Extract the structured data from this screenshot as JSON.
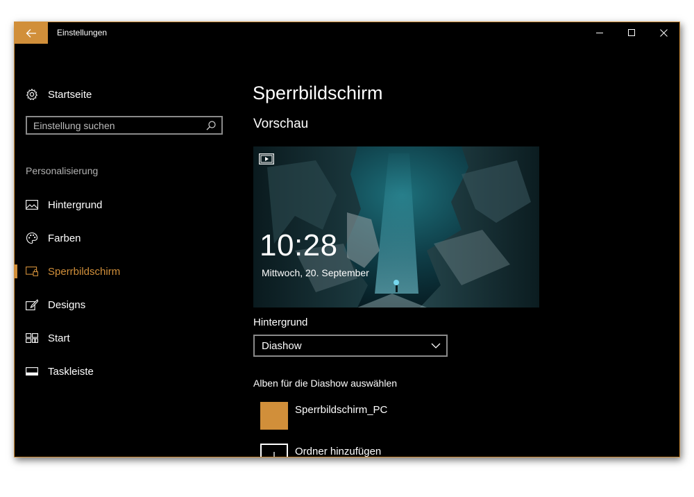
{
  "window": {
    "title": "Einstellungen",
    "accent": "#d18f3a",
    "controls": {
      "minimize": "minimize-icon",
      "maximize": "maximize-icon",
      "close": "close-icon"
    }
  },
  "sidebar": {
    "home": {
      "label": "Startseite",
      "icon": "gear-icon"
    },
    "search": {
      "placeholder": "Einstellung suchen",
      "value": ""
    },
    "section": "Personalisierung",
    "items": [
      {
        "label": "Hintergrund",
        "icon": "picture-icon"
      },
      {
        "label": "Farben",
        "icon": "palette-icon"
      },
      {
        "label": "Sperrbildschirm",
        "icon": "lockscreen-icon",
        "active": true
      },
      {
        "label": "Designs",
        "icon": "brush-icon"
      },
      {
        "label": "Start",
        "icon": "start-tiles-icon"
      },
      {
        "label": "Taskleiste",
        "icon": "taskbar-icon"
      }
    ]
  },
  "main": {
    "title": "Sperrbildschirm",
    "preview": {
      "heading": "Vorschau",
      "time": "10:28",
      "date": "Mittwoch, 20. September"
    },
    "background": {
      "label": "Hintergrund",
      "selected": "Diashow"
    },
    "albums": {
      "label": "Alben für die Diashow auswählen",
      "items": [
        {
          "name": "Sperrbildschirm_PC"
        }
      ],
      "add_label": "Ordner hinzufügen"
    }
  }
}
